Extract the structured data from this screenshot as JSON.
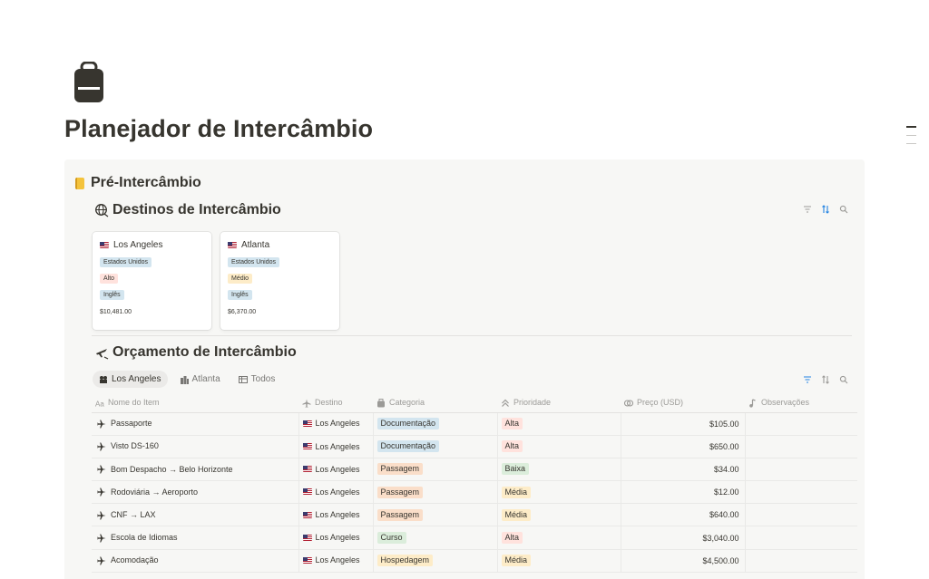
{
  "page": {
    "title": "Planejador de Intercâmbio",
    "icon": "backpack-icon"
  },
  "colors": {
    "tag_blue_bg": "#d3e5ef",
    "tag_red_bg": "#ffe2dd",
    "tag_yellow_bg": "#fdecc8",
    "tag_orange_bg": "#fadec9",
    "tag_green_bg": "#dbeddb",
    "tag_gray_text": "#37352f",
    "callout_bg": "#f7f7f5"
  },
  "callout": {
    "title": "Pré-Intercâmbio",
    "icon": "notebook-icon"
  },
  "destinations": {
    "title": "Destinos de Intercâmbio",
    "icon": "globe-icon",
    "cards": [
      {
        "name": "Los Angeles",
        "country": "Estados Unidos",
        "level": "Alto",
        "language": "Inglês",
        "price": "$10,481.00",
        "level_color": "red"
      },
      {
        "name": "Atlanta",
        "country": "Estados Unidos",
        "level": "Médio",
        "language": "Inglês",
        "price": "$6,370.00",
        "level_color": "yellow"
      }
    ]
  },
  "budget": {
    "title": "Orçamento de Intercâmbio",
    "icon": "plane-icon",
    "tabs": [
      {
        "label": "Los Angeles",
        "icon": "los-angeles-icon",
        "active": true
      },
      {
        "label": "Atlanta",
        "icon": "building-icon",
        "active": false
      },
      {
        "label": "Todos",
        "icon": "table-icon",
        "active": false
      }
    ],
    "columns": [
      {
        "label": "Nome do Item",
        "icon": "text-icon"
      },
      {
        "label": "Destino",
        "icon": "plane-icon"
      },
      {
        "label": "Categoria",
        "icon": "bag-icon"
      },
      {
        "label": "Prioridade",
        "icon": "chevrons-up-icon"
      },
      {
        "label": "Preço (USD)",
        "icon": "coins-icon"
      },
      {
        "label": "Observações",
        "icon": "music-note-icon"
      }
    ],
    "rows": [
      {
        "name": "Passaporte",
        "dest": "Los Angeles",
        "category": "Documentação",
        "cat_color": "blue",
        "priority": "Alta",
        "pri_color": "red",
        "price": "$105.00",
        "notes": ""
      },
      {
        "name": "Visto DS-160",
        "dest": "Los Angeles",
        "category": "Documentação",
        "cat_color": "blue",
        "priority": "Alta",
        "pri_color": "red",
        "price": "$650.00",
        "notes": ""
      },
      {
        "name": "Bom Despacho → Belo Horizonte",
        "dest": "Los Angeles",
        "category": "Passagem",
        "cat_color": "orange",
        "priority": "Baixa",
        "pri_color": "green",
        "price": "$34.00",
        "notes": ""
      },
      {
        "name": "Rodoviária → Aeroporto",
        "dest": "Los Angeles",
        "category": "Passagem",
        "cat_color": "orange",
        "priority": "Média",
        "pri_color": "yellow",
        "price": "$12.00",
        "notes": ""
      },
      {
        "name": "CNF → LAX",
        "dest": "Los Angeles",
        "category": "Passagem",
        "cat_color": "orange",
        "priority": "Média",
        "pri_color": "yellow",
        "price": "$640.00",
        "notes": ""
      },
      {
        "name": "Escola de Idiomas",
        "dest": "Los Angeles",
        "category": "Curso",
        "cat_color": "green",
        "priority": "Alta",
        "pri_color": "red",
        "price": "$3,040.00",
        "notes": ""
      },
      {
        "name": "Acomodação",
        "dest": "Los Angeles",
        "category": "Hospedagem",
        "cat_color": "yellow",
        "priority": "Média",
        "pri_color": "yellow",
        "price": "$4,500.00",
        "notes": ""
      }
    ]
  }
}
